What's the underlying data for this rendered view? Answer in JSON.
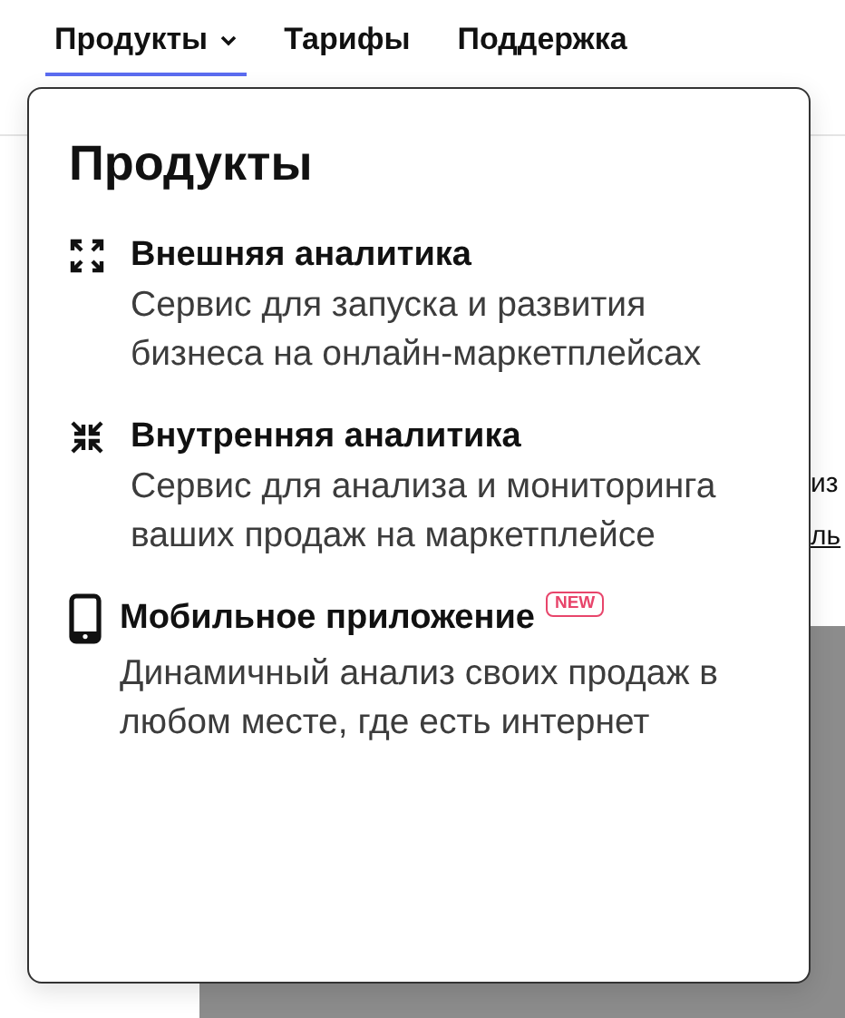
{
  "nav": [
    {
      "label": "Продукты",
      "selected": true,
      "dropdown": true
    },
    {
      "label": "Тарифы",
      "selected": false,
      "dropdown": false
    },
    {
      "label": "Поддержка",
      "selected": false,
      "dropdown": false
    }
  ],
  "background": {
    "text_fragment": "из",
    "link_fragment": "ль"
  },
  "menu": {
    "title": "Продукты",
    "items": [
      {
        "kind": "expand",
        "title": "Внешняя аналитика",
        "description": "Сервис для запуска и развития бизнеса на онлайн-маркетплейсах"
      },
      {
        "kind": "collapse",
        "title": "Внутренняя аналитика",
        "description": "Сервис для анализа и мониторинга ваших продаж на маркетплейсе"
      },
      {
        "kind": "phone",
        "title": "Мобильное приложение",
        "badge": "NEW",
        "description": "Динамичный анализ своих продаж в любом месте, где есть интернет"
      }
    ]
  }
}
